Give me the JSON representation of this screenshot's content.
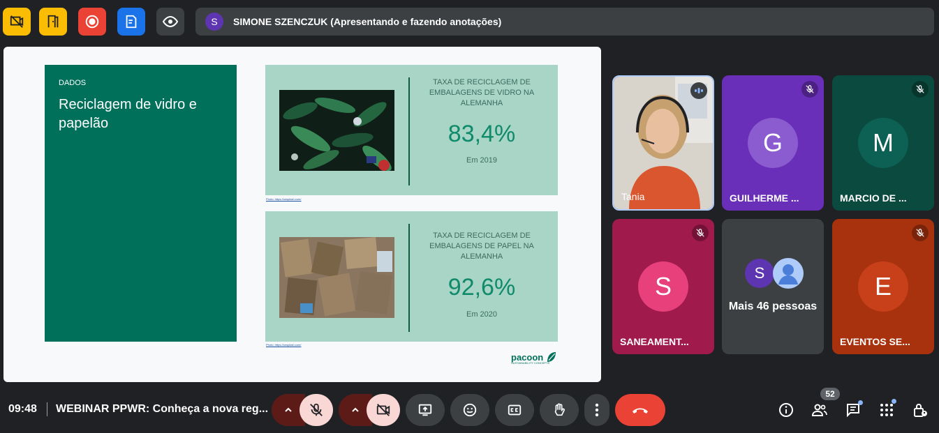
{
  "top_bar": {
    "buttons": [
      {
        "name": "no-video-host-icon",
        "color": "#fbbc04"
      },
      {
        "name": "door-icon",
        "color": "#fbbc04"
      },
      {
        "name": "record-icon",
        "color": "#ea4335"
      },
      {
        "name": "notes-icon",
        "color": "#1a73e8"
      },
      {
        "name": "eye-icon",
        "color": "#3c4043"
      }
    ],
    "presenter_initial": "S",
    "presenter_text": "SIMONE SZENCZUK (Apresentando e fazendo anotações)"
  },
  "slide": {
    "tag": "DADOS",
    "title": "Reciclagem de vidro e papelão",
    "panels": [
      {
        "caption": "TAXA DE RECICLAGEM DE EMBALAGENS DE VIDRO NA ALEMANHA",
        "value": "83,4%",
        "sub": "Em 2019"
      },
      {
        "caption": "TAXA DE RECICLAGEM DE EMBALAGENS DE PAPEL NA ALEMANHA",
        "value": "92,6%",
        "sub": "Em 2020"
      }
    ],
    "logo": "pacoon",
    "logo_sub": "SUSTAINABILITY CONCEPTS",
    "accent": "#00705a"
  },
  "participants": [
    {
      "name": "Tania",
      "initial": "",
      "video": true,
      "bg": "#5a4a42"
    },
    {
      "name": "GUILHERME ...",
      "initial": "G",
      "bg": "#6a2fb8",
      "avatar": "#8a5cd0",
      "muted": true
    },
    {
      "name": "MARCIO DE ...",
      "initial": "M",
      "bg": "#0b4a3e",
      "avatar": "#0d6154",
      "muted": true
    },
    {
      "name": "SANEAMENT...",
      "initial": "S",
      "bg": "#a01a4c",
      "avatar": "#e8407a",
      "muted": true
    },
    {
      "name": "Mais 46 pessoas",
      "initial": "S",
      "bg": "#3c4043",
      "avatar": "#5e35b1"
    },
    {
      "name": "EVENTOS SE...",
      "initial": "E",
      "bg": "#a8320e",
      "avatar": "#c8401a",
      "muted": true
    }
  ],
  "bottom": {
    "time": "09:48",
    "meeting_title": "WEBINAR PPWR: Conheça a nova reg...",
    "people_count": "52",
    "danger_color": "#ea4335",
    "muted_color": "#f9d7d5"
  }
}
